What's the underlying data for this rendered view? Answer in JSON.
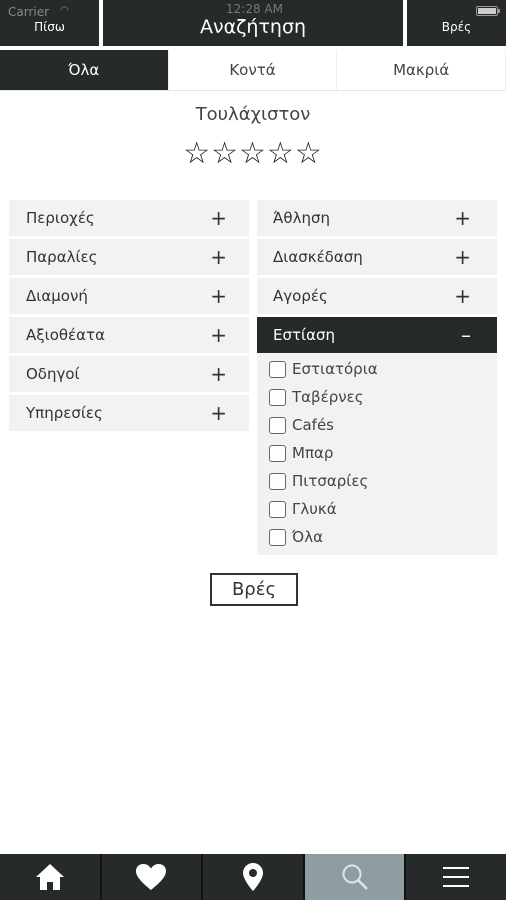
{
  "status": {
    "carrier": "Carrier",
    "time": "12:28 AM"
  },
  "header": {
    "back_label": "Πίσω",
    "title": "Αναζήτηση",
    "find_label": "Βρές"
  },
  "tabs": [
    {
      "label": "Όλα",
      "active": true
    },
    {
      "label": "Κοντά",
      "active": false
    },
    {
      "label": "Μακριά",
      "active": false
    }
  ],
  "rating": {
    "label": "Τουλάχιστον",
    "stars": "☆☆☆☆☆",
    "selected": 0,
    "max": 5
  },
  "categories_left": [
    {
      "label": "Περιοχές",
      "sign": "+"
    },
    {
      "label": "Παραλίες",
      "sign": "+"
    },
    {
      "label": "Διαμονή",
      "sign": "+"
    },
    {
      "label": "Αξιοθέατα",
      "sign": "+"
    },
    {
      "label": "Οδηγοί",
      "sign": "+"
    },
    {
      "label": "Υπηρεσίες",
      "sign": "+"
    }
  ],
  "categories_right": [
    {
      "label": "Άθληση",
      "sign": "+"
    },
    {
      "label": "Διασκέδαση",
      "sign": "+"
    },
    {
      "label": "Αγορές",
      "sign": "+"
    },
    {
      "label": "Εστίαση",
      "sign": "–"
    }
  ],
  "dining_options": [
    {
      "label": "Εστιατόρια",
      "checked": false
    },
    {
      "label": "Ταβέρνες",
      "checked": false
    },
    {
      "label": "Cafés",
      "checked": false
    },
    {
      "label": "Μπαρ",
      "checked": false
    },
    {
      "label": "Πιτσαρίες",
      "checked": false
    },
    {
      "label": "Γλυκά",
      "checked": false
    },
    {
      "label": "Όλα",
      "checked": false
    }
  ],
  "find_button": {
    "label": "Βρές"
  },
  "bottom_nav": [
    {
      "icon": "home-icon",
      "active": false
    },
    {
      "icon": "heart-icon",
      "active": false
    },
    {
      "icon": "map-pin-icon",
      "active": false
    },
    {
      "icon": "search-icon",
      "active": true
    },
    {
      "icon": "menu-icon",
      "active": false
    }
  ],
  "colors": {
    "dark": "#262a2b",
    "active_nav": "#8e9da2",
    "row_bg": "#f2f2f2"
  }
}
